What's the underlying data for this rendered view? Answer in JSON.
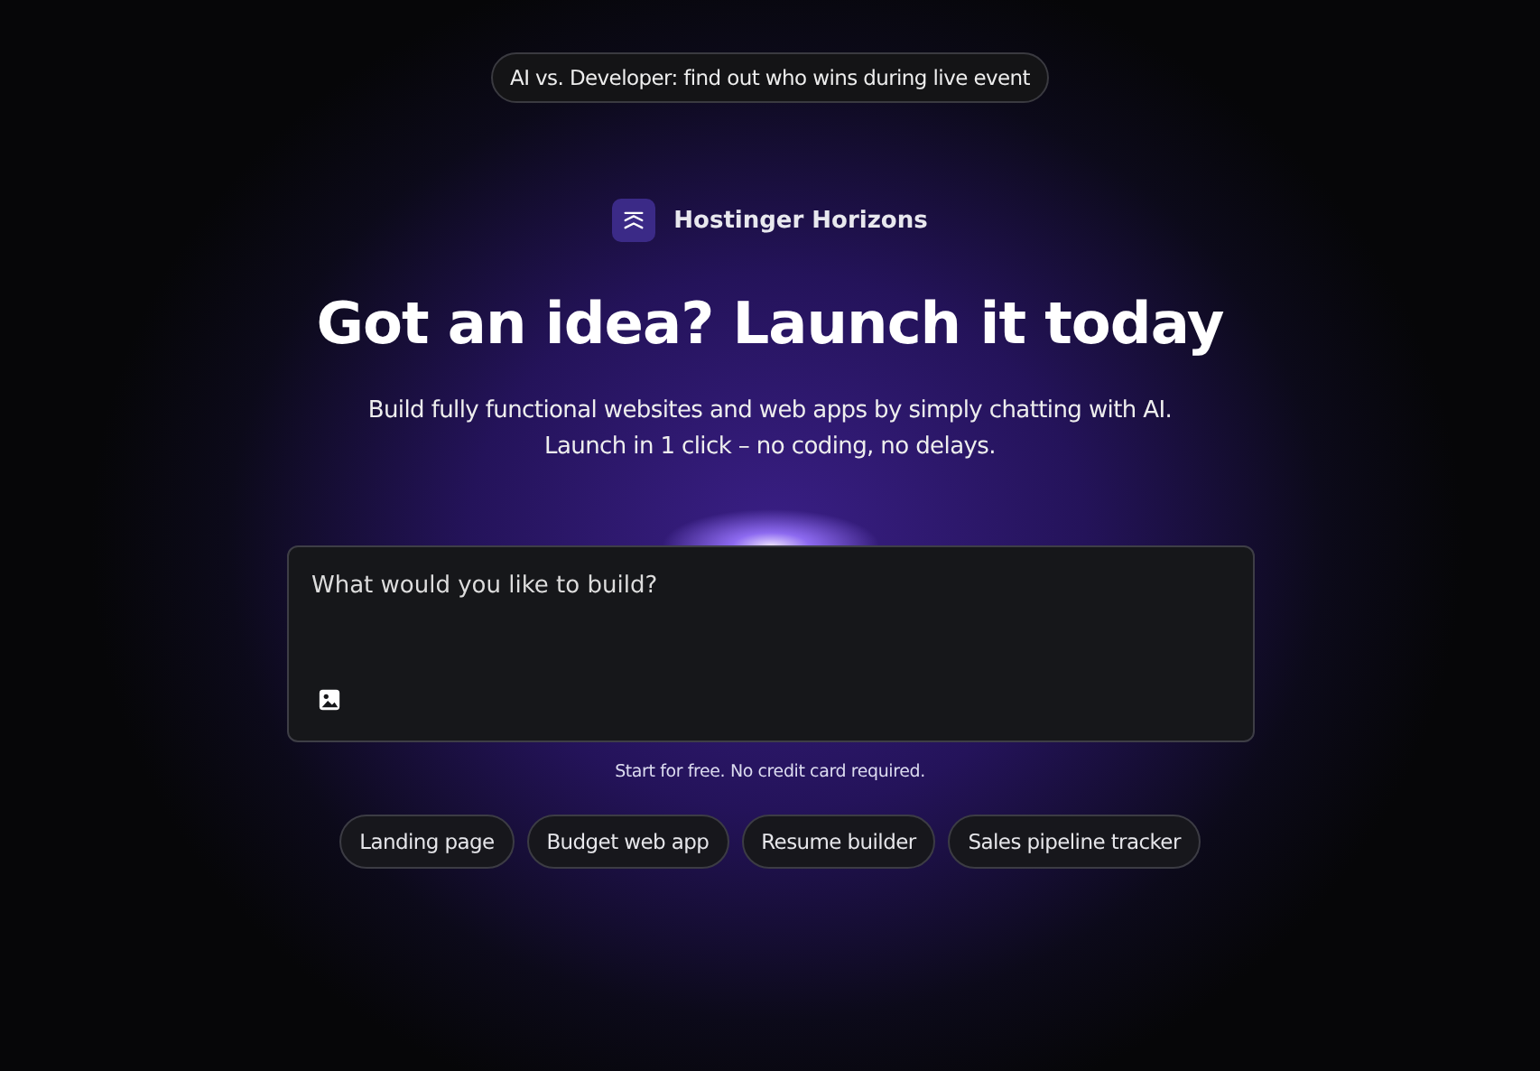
{
  "announcement": "AI vs. Developer: find out who wins during live event",
  "brand": {
    "name": "Hostinger Horizons"
  },
  "headline": "Got an idea? Launch it today",
  "subtitle_lines": [
    "Build fully functional websites and web apps by simply chatting with AI.",
    "Launch in 1 click – no coding, no delays."
  ],
  "prompt": {
    "placeholder": "What would you like to build?"
  },
  "note": "Start for free. No credit card required.",
  "suggestions": [
    "Landing page",
    "Budget web app",
    "Resume builder",
    "Sales pipeline tracker"
  ]
}
